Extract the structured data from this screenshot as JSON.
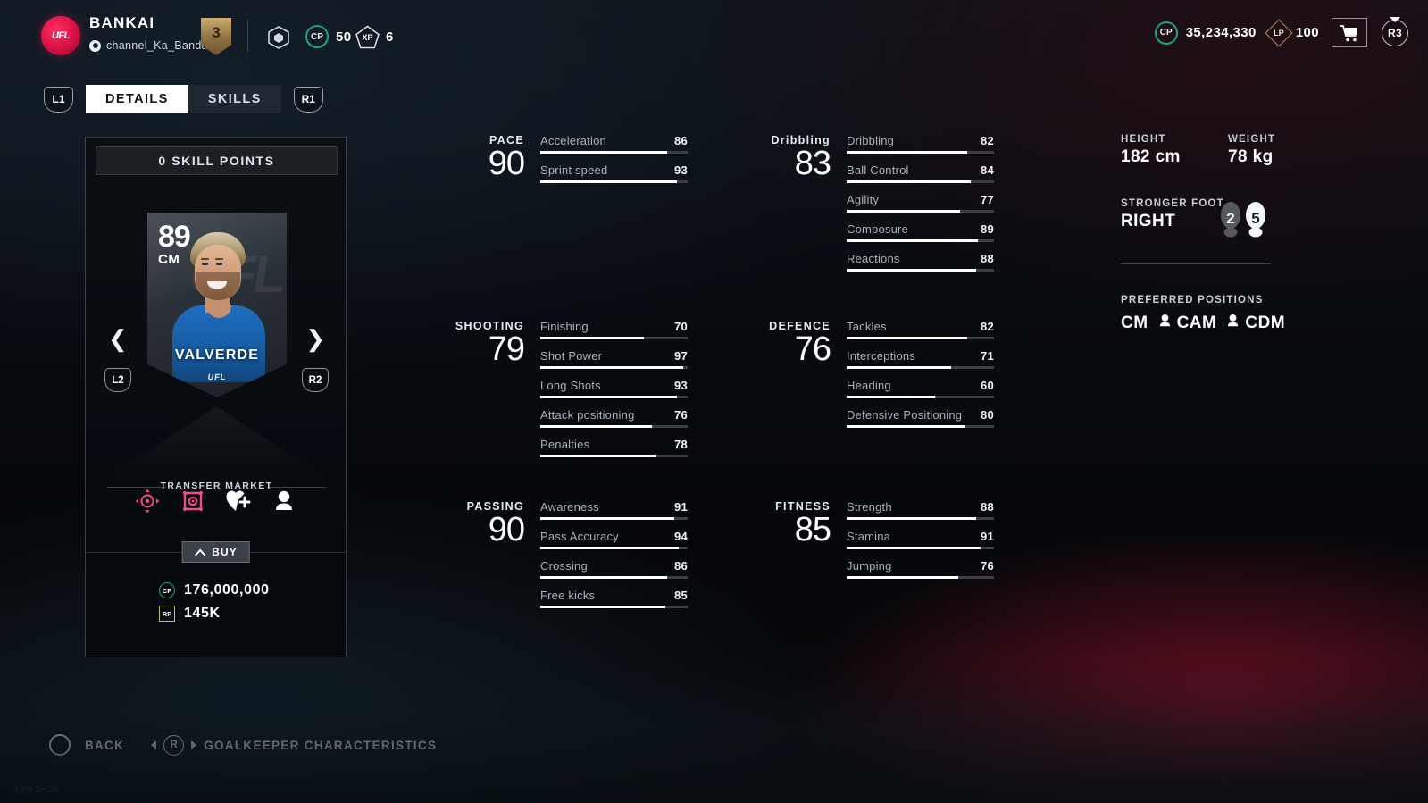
{
  "topbar": {
    "username": "BANKAI",
    "handle": "channel_Ka_Banda",
    "level": "3",
    "cp_label": "CP",
    "cp_small_value": "50",
    "xp_label": "XP",
    "xp_small_value": "6",
    "cp_big_label": "CP",
    "cp_big_value": "35,234,330",
    "lp_label": "LP",
    "lp_value": "100",
    "r3_label": "R3",
    "logo_text": "UFL"
  },
  "tabs": {
    "left_bumper": "L1",
    "right_bumper": "R1",
    "items": [
      {
        "label": "DETAILS",
        "active": true
      },
      {
        "label": "SKILLS",
        "active": false
      }
    ]
  },
  "card": {
    "skill_points": "0 SKILL POINTS",
    "rating": "89",
    "position": "CM",
    "player_name": "VALVERDE",
    "brand": "UFL",
    "left_trigger": "L2",
    "right_trigger": "R2",
    "transfer_market": "TRANSFER MARKET",
    "buy_label": "BUY",
    "prices": [
      {
        "currency": "CP",
        "value": "176,000,000"
      },
      {
        "currency": "RP",
        "value": "145K"
      }
    ],
    "action_icons": [
      "target-icon",
      "upgrade-icon",
      "favourite-add-icon",
      "position-pin-icon"
    ]
  },
  "stats": {
    "columns": [
      {
        "groups": [
          {
            "label": "PACE",
            "value": "90",
            "rows": [
              {
                "name": "Acceleration",
                "value": 86
              },
              {
                "name": "Sprint speed",
                "value": 93
              }
            ]
          },
          {
            "label": "SHOOTING",
            "value": "79",
            "rows": [
              {
                "name": "Finishing",
                "value": 70
              },
              {
                "name": "Shot Power",
                "value": 97
              },
              {
                "name": "Long Shots",
                "value": 93
              },
              {
                "name": "Attack positioning",
                "value": 76
              },
              {
                "name": "Penalties",
                "value": 78
              }
            ]
          },
          {
            "label": "PASSING",
            "value": "90",
            "rows": [
              {
                "name": "Awareness",
                "value": 91
              },
              {
                "name": "Pass Accuracy",
                "value": 94
              },
              {
                "name": "Crossing",
                "value": 86
              },
              {
                "name": "Free kicks",
                "value": 85
              }
            ]
          }
        ]
      },
      {
        "groups": [
          {
            "label": "Dribbling",
            "value": "83",
            "rows": [
              {
                "name": "Dribbling",
                "value": 82
              },
              {
                "name": "Ball Control",
                "value": 84
              },
              {
                "name": "Agility",
                "value": 77
              },
              {
                "name": "Composure",
                "value": 89
              },
              {
                "name": "Reactions",
                "value": 88
              }
            ]
          },
          {
            "label": "DEFENCE",
            "value": "76",
            "rows": [
              {
                "name": "Tackles",
                "value": 82
              },
              {
                "name": "Interceptions",
                "value": 71
              },
              {
                "name": "Heading",
                "value": 60
              },
              {
                "name": "Defensive Positioning",
                "value": 80
              }
            ]
          },
          {
            "label": "FITNESS",
            "value": "85",
            "rows": [
              {
                "name": "Strength",
                "value": 88
              },
              {
                "name": "Stamina",
                "value": 91
              },
              {
                "name": "Jumping",
                "value": 76
              }
            ]
          }
        ]
      }
    ]
  },
  "info": {
    "height_label": "HEIGHT",
    "height_value": "182 cm",
    "weight_label": "WEIGHT",
    "weight_value": "78 kg",
    "foot_label": "STRONGER FOOT",
    "foot_value": "RIGHT",
    "foot_left_rating": "2",
    "foot_right_rating": "5",
    "positions_label": "PREFERRED POSITIONS",
    "positions": [
      {
        "name": "CM",
        "pinned": false
      },
      {
        "name": "CAM",
        "pinned": true
      },
      {
        "name": "CDM",
        "pinned": true
      }
    ]
  },
  "bottom": {
    "back_label": "BACK",
    "shortcut_key": "R",
    "shortcut_label": "GOALKEEPER CHARACTERISTICS",
    "version": "0.60.2+25"
  },
  "colors": {
    "accent_pink": "#ef4c7f",
    "accent_green": "#19a47c",
    "accent_gold": "#cdab6c",
    "bar_fill": "#ffffff",
    "bar_track": "#3a3f45"
  }
}
